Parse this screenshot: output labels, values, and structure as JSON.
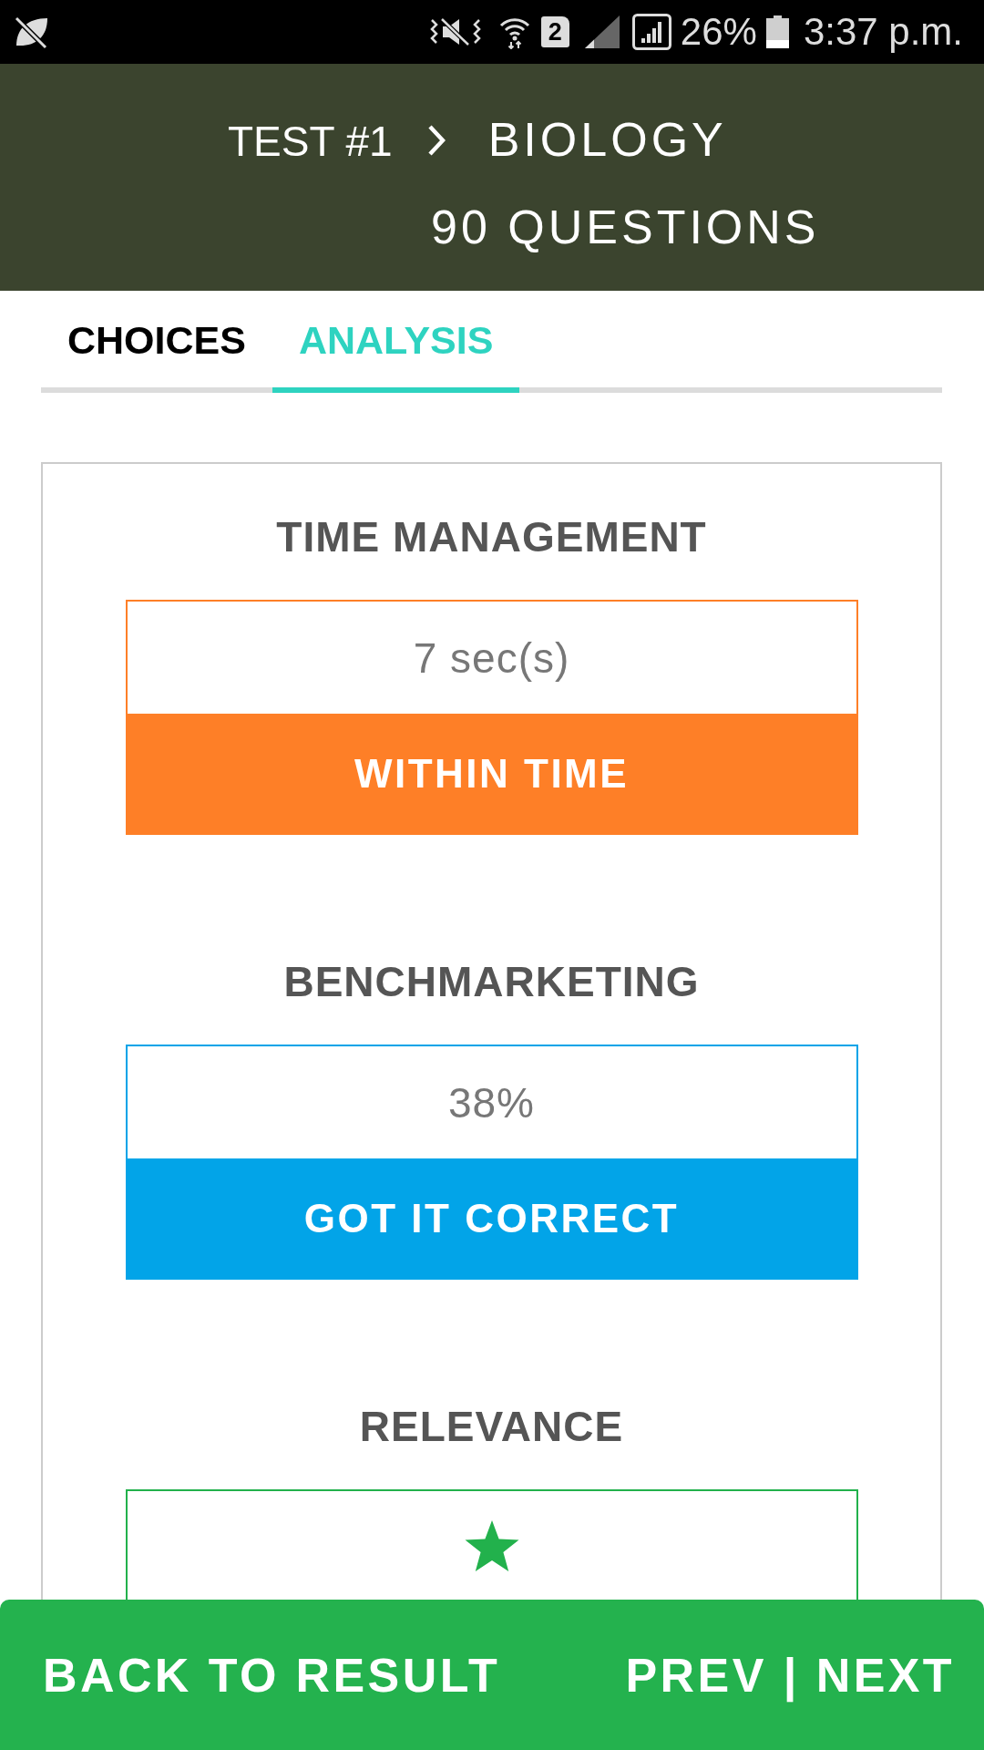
{
  "status_bar": {
    "sim": "2",
    "battery": "26%",
    "time": "3:37 p.m."
  },
  "header": {
    "test": "TEST #1",
    "subject": "BIOLOGY",
    "question_count": "90 QUESTIONS"
  },
  "tabs": [
    {
      "label": "CHOICES",
      "selected": false
    },
    {
      "label": "ANALYSIS",
      "selected": true
    }
  ],
  "sections": [
    {
      "kind": "text",
      "title": "TIME MANAGEMENT",
      "value": "7 sec(s)",
      "verdict": "WITHIN TIME",
      "color": "#fe7f27"
    },
    {
      "kind": "text",
      "title": "BENCHMARKETING",
      "value": "38%",
      "verdict": "GOT IT CORRECT",
      "color": "#02a4e8"
    },
    {
      "kind": "star",
      "title": "RELEVANCE",
      "color": "#22b14c"
    }
  ],
  "footer": {
    "back": "BACK TO RESULT",
    "prev": "PREV",
    "separator": "|",
    "next": "NEXT"
  }
}
